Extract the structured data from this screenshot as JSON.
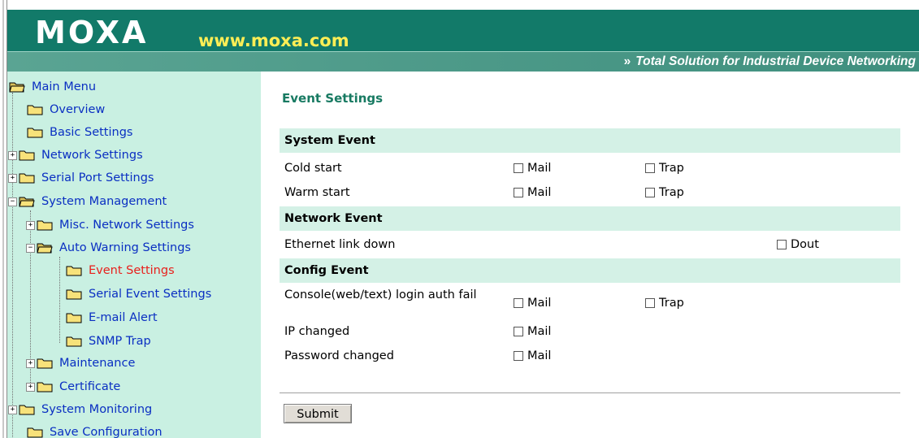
{
  "header": {
    "logo": "MOXA",
    "url": "www.moxa.com",
    "tagline_arrow": "»",
    "tagline": "Total Solution for Industrial Device Networking"
  },
  "sidebar": {
    "items": [
      {
        "label": "Main Menu",
        "toggle": "",
        "open": true
      },
      {
        "label": "Overview",
        "toggle": ""
      },
      {
        "label": "Basic Settings",
        "toggle": ""
      },
      {
        "label": "Network Settings",
        "toggle": "+"
      },
      {
        "label": "Serial Port Settings",
        "toggle": "+"
      },
      {
        "label": "System Management",
        "toggle": "−",
        "open": true
      },
      {
        "label": "Misc. Network Settings",
        "toggle": "+"
      },
      {
        "label": "Auto Warning Settings",
        "toggle": "−",
        "open": true
      },
      {
        "label": "Event Settings",
        "toggle": "",
        "active": true
      },
      {
        "label": "Serial Event Settings",
        "toggle": ""
      },
      {
        "label": "E-mail Alert",
        "toggle": ""
      },
      {
        "label": "SNMP Trap",
        "toggle": ""
      },
      {
        "label": "Maintenance",
        "toggle": "+"
      },
      {
        "label": "Certificate",
        "toggle": "+"
      },
      {
        "label": "System Monitoring",
        "toggle": "+"
      },
      {
        "label": "Save Configuration",
        "toggle": ""
      }
    ],
    "icons": {
      "folder": "folder-icon",
      "folder_open": "folder-open-icon",
      "plus": "plus-toggle-icon",
      "minus": "minus-toggle-icon"
    }
  },
  "main": {
    "title": "Event Settings",
    "sections": {
      "system_event": "System Event",
      "network_event": "Network Event",
      "config_event": "Config Event"
    },
    "rows": {
      "cold_start": "Cold start",
      "warm_start": "Warm start",
      "ethernet_link_down": "Ethernet link down",
      "console_login_fail": "Console(web/text) login auth fail",
      "ip_changed": "IP changed",
      "password_changed": "Password changed"
    },
    "options": {
      "mail": "Mail",
      "trap": "Trap",
      "dout": "Dout"
    },
    "submit": "Submit"
  },
  "colors": {
    "header_green": "#127a69",
    "sidebar_bg": "#c9f0e2",
    "section_bg": "#d4f1e6",
    "title_green": "#187a62",
    "link_blue": "#0a2fc2",
    "active_red": "#e8201c",
    "url_yellow": "#ffee55"
  }
}
